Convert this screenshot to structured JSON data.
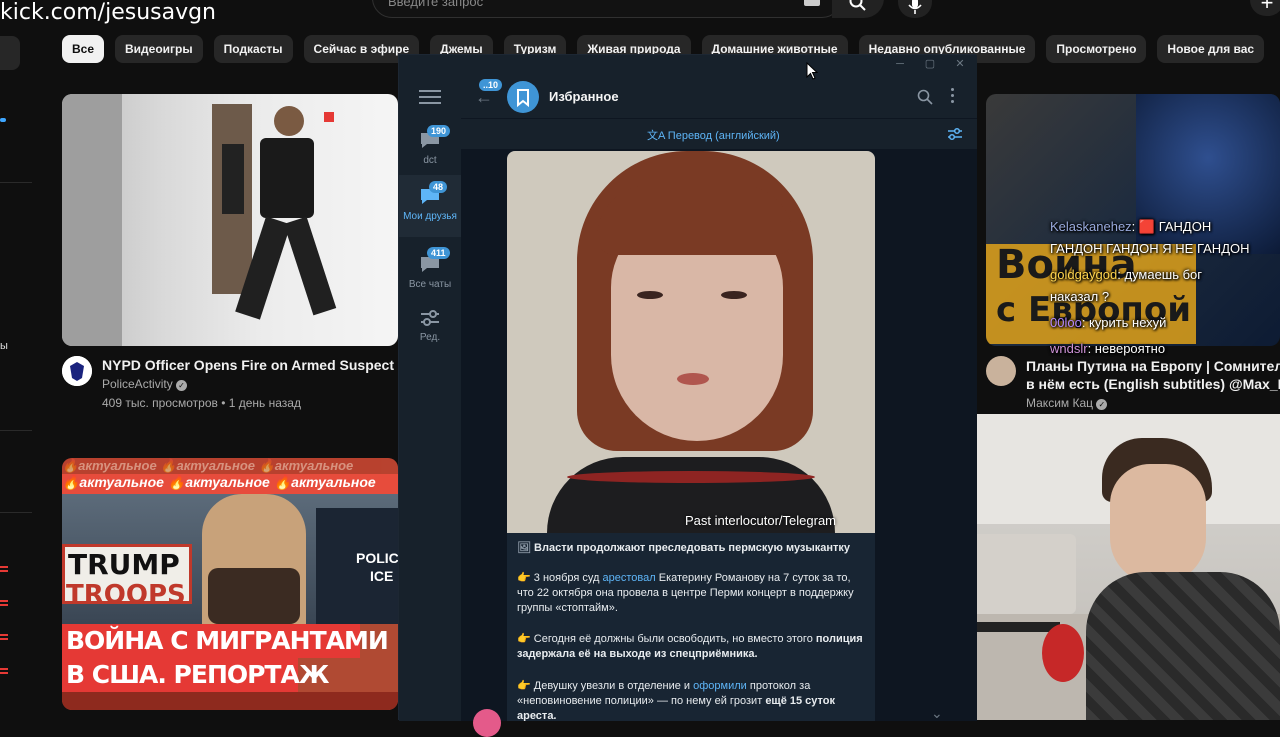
{
  "overlay": {
    "channel_url": "kick.com/jesusavgn"
  },
  "youtube": {
    "search_placeholder": "Введите запрос",
    "chips": [
      "Все",
      "Видеоигры",
      "Подкасты",
      "Сейчас в эфире",
      "Джемы",
      "Туризм",
      "Живая природа",
      "Домашние животные",
      "Недавно опубликованные",
      "Просмотрено",
      "Новое для вас"
    ],
    "active_chip": "Все",
    "videos": [
      {
        "title": "NYPD Officer Opens Fire on Armed Suspect Tryin",
        "channel": "PoliceActivity",
        "meta": "409 тыс. просмотров • 1 день назад",
        "verified": true
      },
      {
        "thumb_text_top": "🔥актуальное 🔥актуальное 🔥актуальное",
        "thumb_headline_1": "ВОЙНА С МИГРАНТАМИ",
        "thumb_headline_2": "В США. РЕПОРТАЖ",
        "sign_1": "TRUMP",
        "sign_2": "TROOPS",
        "sign_police": "POLICE",
        "sign_ice": "ICE"
      },
      {
        "title_1": "Планы Путина на Европу | Сомнительны",
        "title_2": "в нём есть (English subtitles) @Max_Katz",
        "channel": "Максим Кац",
        "verified": true,
        "thumb_line_1": "Война",
        "thumb_line_2": "с Европой"
      }
    ]
  },
  "telegram": {
    "chat_title": "Избранное",
    "back_badge": "10",
    "translate_bar": "Перевод (английский)",
    "folders": [
      {
        "label": "dct",
        "badge": "190",
        "active": false
      },
      {
        "label": "Мои друзья",
        "badge": "48",
        "active": true
      },
      {
        "label": "Все чаты",
        "badge": "411",
        "active": false
      },
      {
        "label": "Ред.",
        "badge": "",
        "active": false
      }
    ],
    "photo_caption": "Past interlocutor/Telegram",
    "message": {
      "headline": "Власти продолжают преследовать пермскую музыкантку",
      "p1_pre": "3 ноября суд ",
      "p1_link": "арестовал",
      "p1_post": " Екатерину Романову на 7 суток за то, что 22 октября она провела в центре Перми концерт в поддержку группы «стоптайм».",
      "p2_pre": "Сегодня её должны были освободить, но вместо этого ",
      "p2_bold": "полиция задержала её на выходе из спецприёмника.",
      "p3_pre": "Девушку увезли в отделение и ",
      "p3_link": "оформили",
      "p3_mid": " протокол за «неповиновение полиции» — по нему ей грозит ",
      "p3_bold": "ещё 15 суток ареста."
    }
  },
  "stream_chat": [
    {
      "user": "Kelaskanehez",
      "text": ": 🟥 ГАНДОН",
      "color": "#ffffff"
    },
    {
      "user": "",
      "text": "ГАНДОН ГАНДОН Я НЕ ГАНДОН",
      "color": "#ffffff"
    },
    {
      "user": "goldgaygod",
      "text": ": думаешь бог",
      "color": "#ffd54f"
    },
    {
      "user": "",
      "text": "наказал ?",
      "color": "#ffffff"
    },
    {
      "user": "00loo",
      "text": ": курить нехуй",
      "color": "#b388ff"
    },
    {
      "user": "wndslr",
      "text": ": невероятно",
      "color": "#ce93d8"
    }
  ],
  "colors": {
    "tg_accent": "#3f95d6",
    "tg_bg": "#0e1621",
    "yt_bg": "#0f0f0f"
  }
}
